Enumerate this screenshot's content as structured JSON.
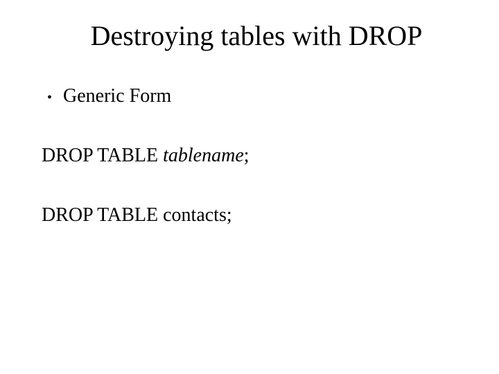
{
  "title": "Destroying tables with DROP",
  "bullet": {
    "marker": "•",
    "text": "Generic Form"
  },
  "line1": {
    "prefix": "DROP TABLE ",
    "italic": "tablename",
    "suffix": ";"
  },
  "line2": "DROP TABLE contacts;"
}
